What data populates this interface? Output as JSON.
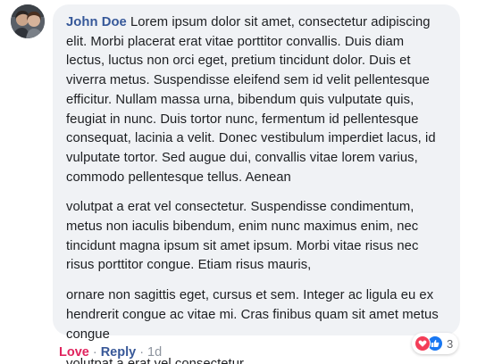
{
  "comment": {
    "author": "John Doe",
    "paragraphs": [
      "Lorem ipsum dolor sit amet, consectetur adipiscing elit. Morbi placerat erat vitae porttitor convallis. Duis diam lectus, luctus non orci eget, pretium tincidunt dolor. Duis et viverra metus. Suspendisse eleifend sem id velit pellentesque efficitur. Nullam massa urna, bibendum quis vulputate quis, feugiat in nunc. Duis tortor nunc, fermentum id pellentesque consequat, lacinia a velit. Donec vestibulum imperdiet lacus, id vulputate tortor. Sed augue dui, convallis vitae lorem varius, commodo pellentesque tellus. Aenean",
      "volutpat a erat vel consectetur. Suspendisse condimentum, metus non iaculis bibendum, enim nunc maximus enim, nec tincidunt magna ipsum sit amet ipsum. Morbi vitae risus nec risus porttitor congue. Etiam risus mauris,",
      "ornare non sagittis eget, cursus et sem. Integer ac ligula eu ex hendrerit congue ac vitae mi. Cras finibus quam sit amet metus congue",
      "volutpat a erat vel consectetur."
    ]
  },
  "actions": {
    "love_label": "Love",
    "reply_label": "Reply",
    "separator": "·",
    "time": "1d"
  },
  "reactions": {
    "icons": [
      "heart-icon",
      "thumbs-up-icon"
    ],
    "count": "3"
  },
  "colors": {
    "bubble": "#f0f2f5",
    "author": "#365899",
    "love": "#e0245e",
    "reply": "#385898",
    "like": "#1877f2",
    "heart": "#f33e58"
  }
}
